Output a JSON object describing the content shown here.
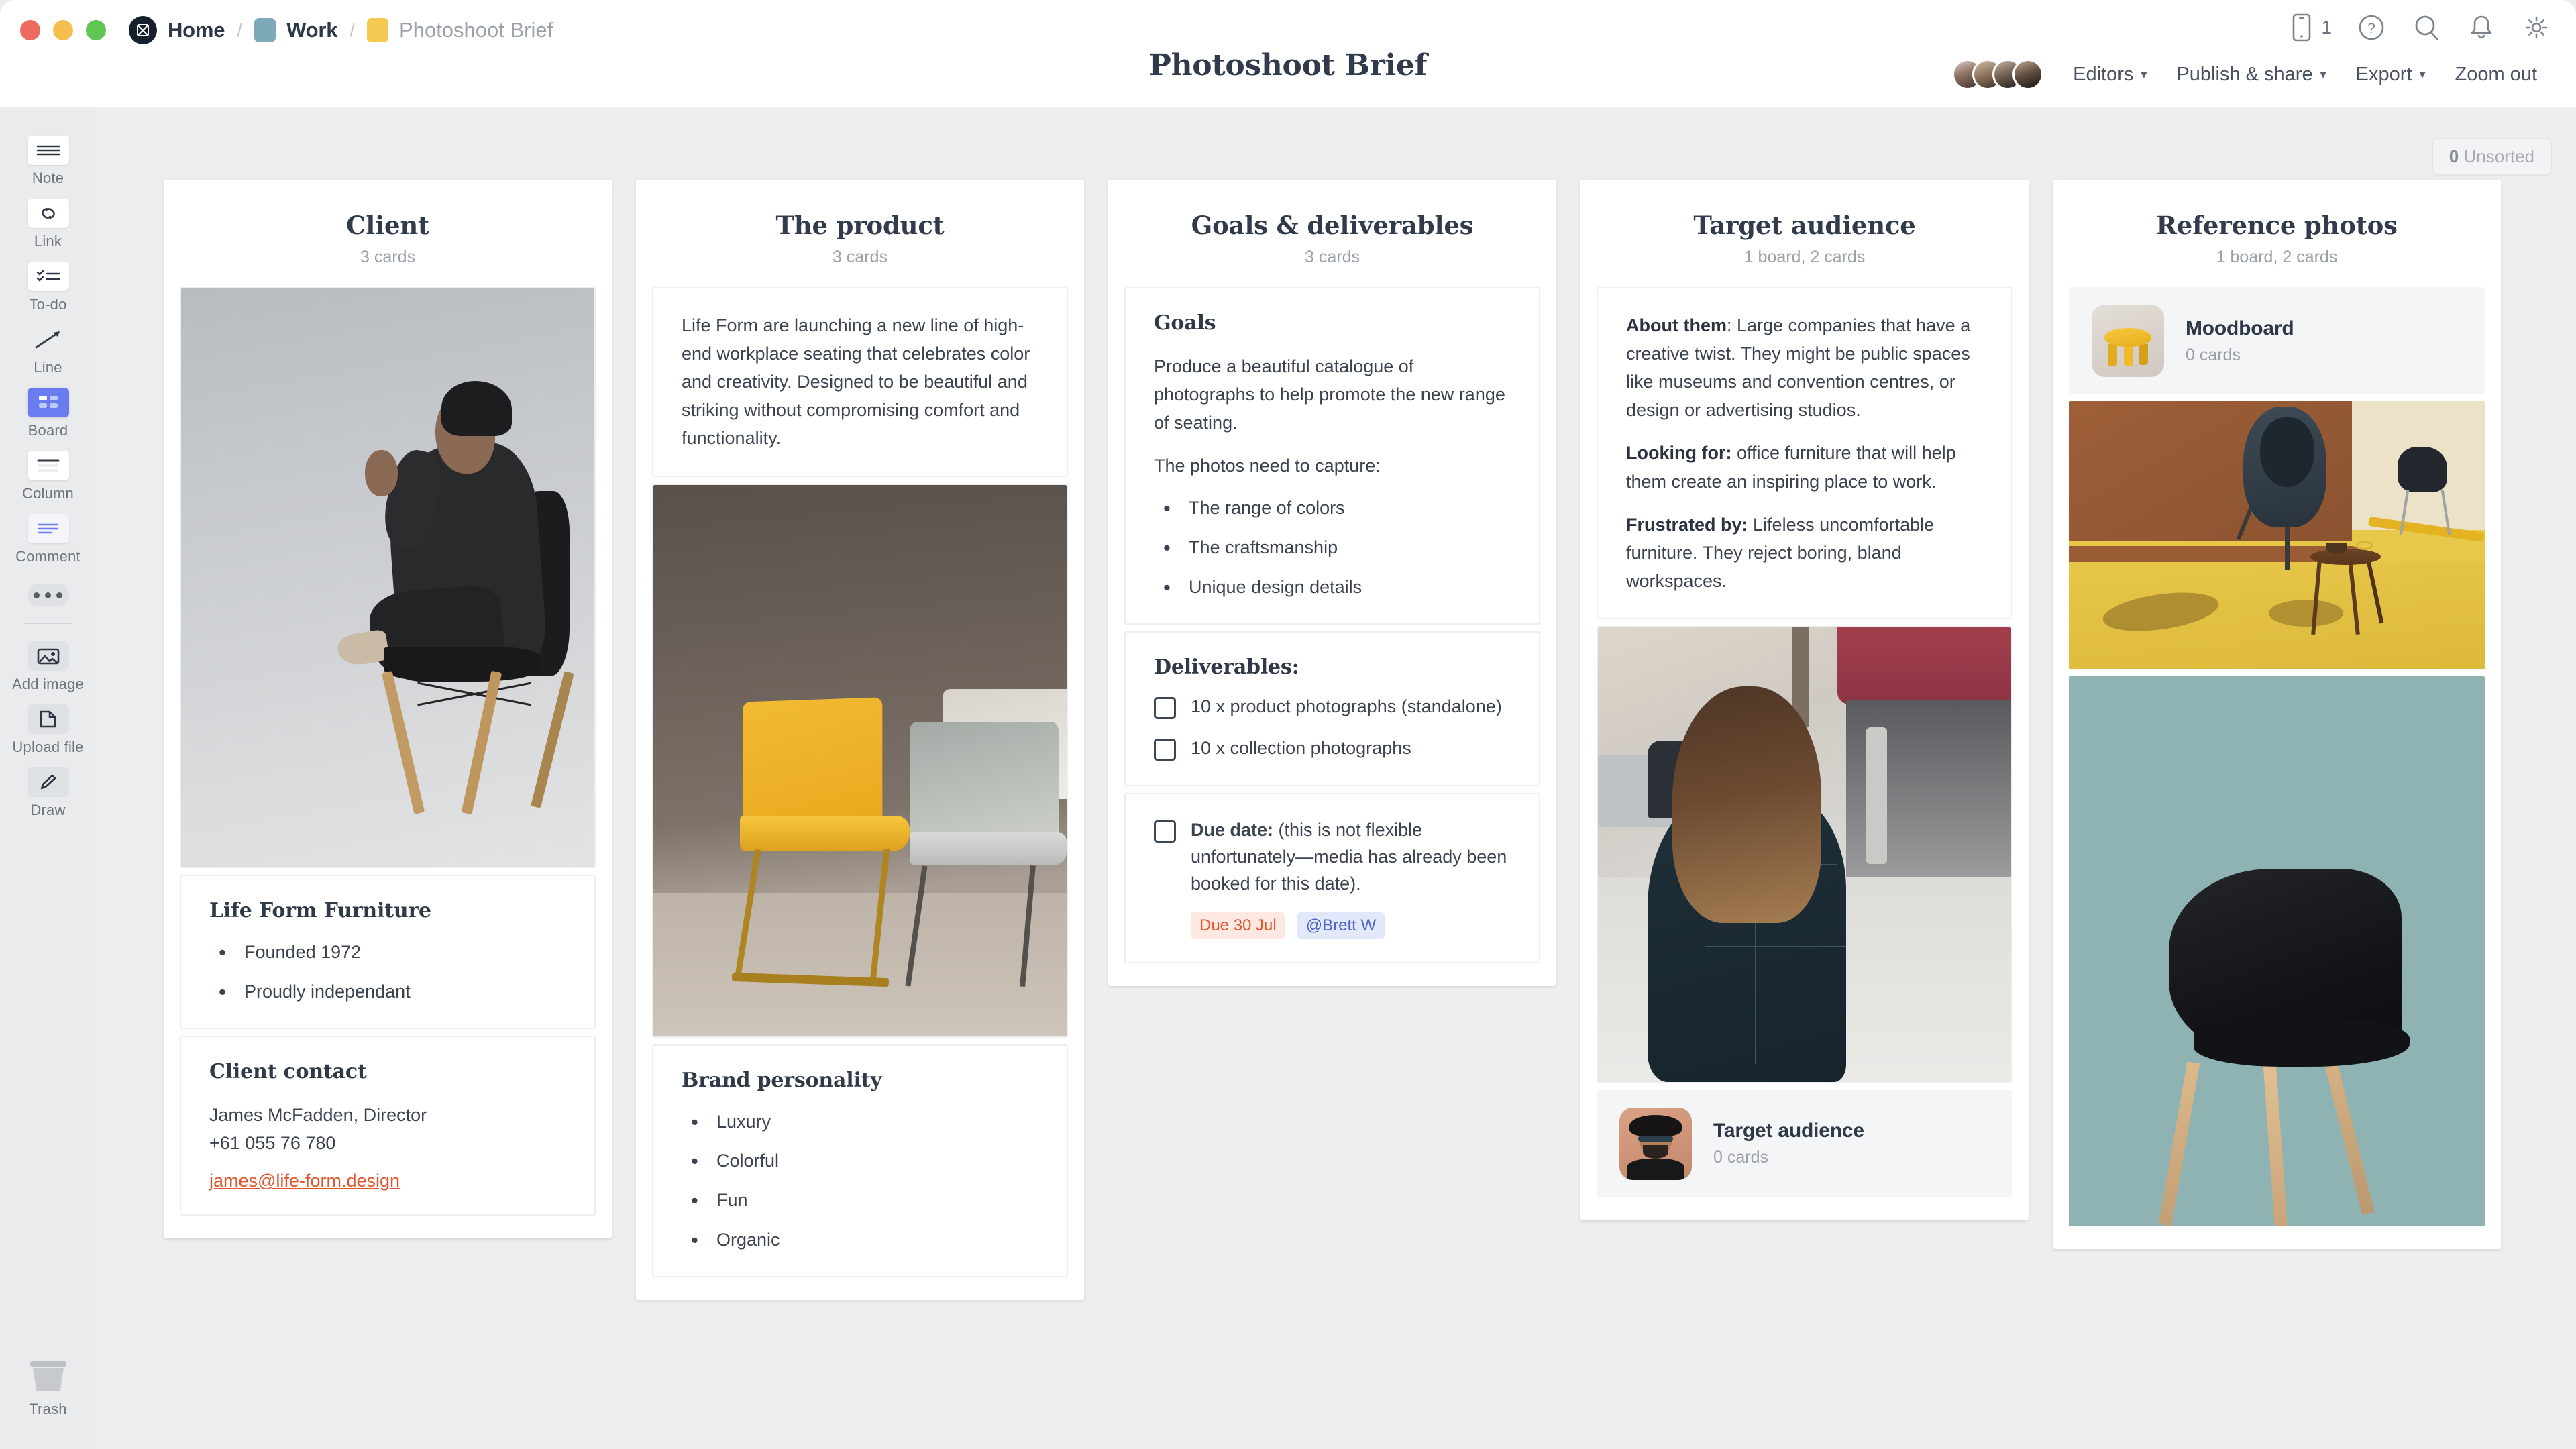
{
  "window": {
    "traffic_lights": [
      "close",
      "minimize",
      "maximize"
    ]
  },
  "breadcrumb": {
    "home_label": "Home",
    "work_label": "Work",
    "current_label": "Photoshoot Brief",
    "separator": "/",
    "work_chip_color": "#7da9b8",
    "current_chip_color": "#f5c94f"
  },
  "header": {
    "title": "Photoshoot Brief",
    "icons": [
      "mobile-icon",
      "help-icon",
      "search-icon",
      "notifications-icon",
      "settings-icon"
    ],
    "mobile_count": "1",
    "actions": [
      {
        "label": "Editors",
        "caret": "⌄"
      },
      {
        "label": "Publish & share",
        "caret": "⌄"
      },
      {
        "label": "Export",
        "caret": "⌄"
      },
      {
        "label": "Zoom out",
        "caret": ""
      }
    ]
  },
  "toolbar": {
    "items": [
      {
        "label": "Note",
        "icon": "note-icon",
        "active": false
      },
      {
        "label": "Link",
        "icon": "link-icon",
        "active": false
      },
      {
        "label": "To-do",
        "icon": "todo-icon",
        "active": false
      },
      {
        "label": "Line",
        "icon": "line-icon",
        "active": false
      },
      {
        "label": "Board",
        "icon": "board-icon",
        "active": true
      },
      {
        "label": "Column",
        "icon": "column-icon",
        "active": false
      },
      {
        "label": "Comment",
        "icon": "comment-icon",
        "active": false
      }
    ],
    "more_label": "more-options",
    "upload_items": [
      {
        "label": "Add image",
        "icon": "image-icon"
      },
      {
        "label": "Upload file",
        "icon": "file-icon"
      },
      {
        "label": "Draw",
        "icon": "pencil-icon"
      }
    ],
    "trash_label": "Trash",
    "accent_color": "#6b7cf0"
  },
  "canvas": {
    "unsorted_count": "0",
    "unsorted_label": "Unsorted"
  },
  "columns": [
    {
      "title": "Client",
      "subtitle": "3 cards",
      "cards": [
        {
          "type": "image",
          "name": "client-photo"
        },
        {
          "type": "note",
          "heading": "Life Form Furniture",
          "bullets": [
            "Founded 1972",
            "Proudly independant"
          ]
        },
        {
          "type": "contact",
          "heading": "Client contact",
          "lines": [
            "James McFadden, Director",
            "+61 055 76 780"
          ],
          "email": "james@life-form.design"
        }
      ]
    },
    {
      "title": "The product",
      "subtitle": "3 cards",
      "cards": [
        {
          "type": "note",
          "body": "Life Form are launching a new line of high-end workplace seating that celebrates color and creativity. Designed to be beautiful and striking without compromising comfort and functionality."
        },
        {
          "type": "image",
          "name": "product-photo"
        },
        {
          "type": "note",
          "heading": "Brand personality",
          "bullets": [
            "Luxury",
            "Colorful",
            "Fun",
            "Organic"
          ]
        }
      ]
    },
    {
      "title": "Goals & deliverables",
      "subtitle": "3 cards",
      "cards": [
        {
          "type": "note",
          "heading": "Goals",
          "paragraphs": [
            "Produce a beautiful catalogue of photographs to help promote the new range of seating.",
            "The photos need to capture:"
          ],
          "bullets": [
            "The range of colors",
            "The craftsmanship",
            "Unique design details"
          ]
        },
        {
          "type": "todo",
          "heading": "Deliverables:",
          "todos": [
            {
              "text": "10 x product photographs (standalone)",
              "checked": false
            },
            {
              "text": "10 x collection photographs",
              "checked": false
            }
          ]
        },
        {
          "type": "todo",
          "todos": [
            {
              "bold": "Due date:",
              "text": " (this is not flexible unfortunately—media has already been booked for this date).",
              "checked": false
            }
          ],
          "tags": [
            {
              "label": "Due 30 Jul",
              "kind": "due",
              "color": "#e0562e"
            },
            {
              "label": "@Brett W",
              "kind": "mention",
              "color": "#4a63c4"
            }
          ]
        }
      ]
    },
    {
      "title": "Target audience",
      "subtitle": "1 board, 2 cards",
      "cards": [
        {
          "type": "note",
          "paragraphs": [
            {
              "bold": "About them",
              "rest": ": Large companies that have a creative twist. They might be public spaces like museums and convention centres, or design or advertising studios."
            },
            {
              "bold": "Looking for:",
              "rest": " office furniture that will help them create an inspiring place to work."
            },
            {
              "bold": "Frustrated by:",
              "rest": " Lifeless uncomfortable furniture. They reject boring, bland workspaces."
            }
          ]
        },
        {
          "type": "image",
          "name": "audience-photo"
        },
        {
          "type": "board",
          "name": "Target audience",
          "count": "0 cards",
          "thumb": "target-audience-thumb"
        }
      ]
    },
    {
      "title": "Reference photos",
      "subtitle": "1 board, 2 cards",
      "cards": [
        {
          "type": "board",
          "name": "Moodboard",
          "count": "0 cards",
          "thumb": "moodboard-thumb"
        },
        {
          "type": "image",
          "name": "reference-photo-1"
        },
        {
          "type": "image",
          "name": "reference-photo-2"
        }
      ]
    }
  ]
}
